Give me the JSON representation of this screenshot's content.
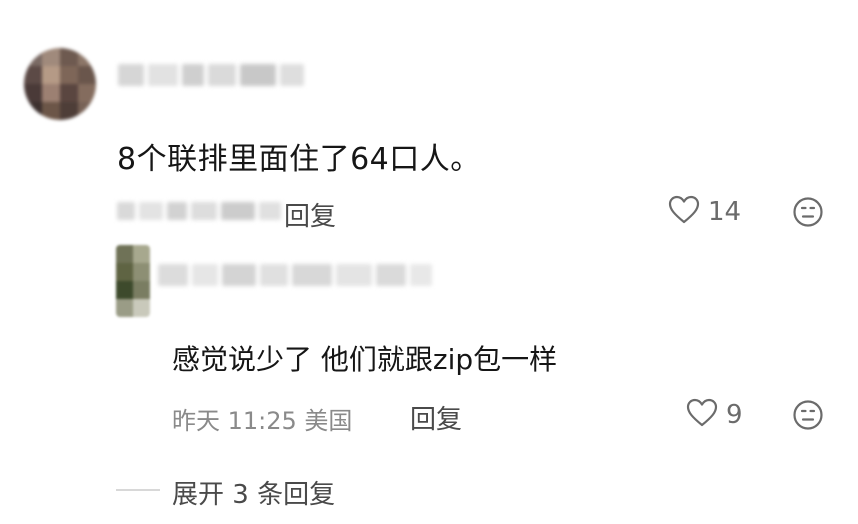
{
  "comment": {
    "text": "8个联排里面住了64口人。",
    "reply_label": "回复",
    "like_count": "14",
    "avatar_colors": [
      "#7a6a64",
      "#a08a7c",
      "#6e5a50",
      "#8c7668",
      "#5c4a46",
      "#b59a86",
      "#7e6658",
      "#6a564c",
      "#4a3a38",
      "#9c8072",
      "#5a4640",
      "#846c5e",
      "#3c302e",
      "#6c5648",
      "#4e3e38",
      "#786256"
    ]
  },
  "reply": {
    "text": "感觉说少了 他们就跟zip包一样",
    "meta": "昨天 11:25 美国",
    "reply_label": "回复",
    "like_count": "9",
    "avatar_colors": [
      "#6f7257",
      "#a7a88e",
      "#5f6443",
      "#8d8f74",
      "#3d4a2c",
      "#7a7d62",
      "#9a9c86",
      "#c9c9bb"
    ]
  },
  "expand": {
    "label": "展开 3 条回复"
  },
  "colors": {
    "text_primary": "#161616",
    "text_meta": "#8a8a8a",
    "icon": "#6b6b6b"
  }
}
